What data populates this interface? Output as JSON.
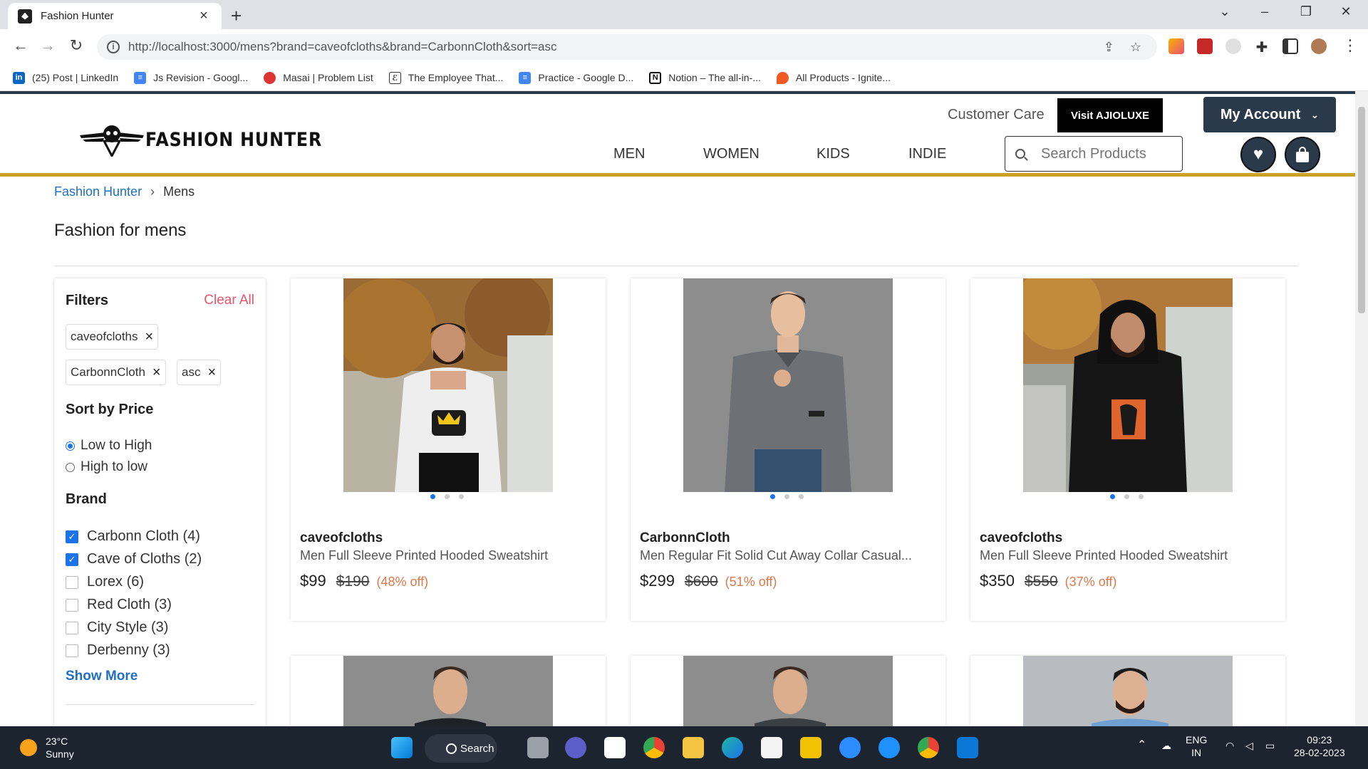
{
  "browser": {
    "tab_title": "Fashion Hunter",
    "url": "http://localhost:3000/mens?brand=caveofcloths&brand=CarbonnCloth&sort=asc",
    "bookmarks": [
      {
        "label": "(25) Post | LinkedIn",
        "icon": "linkedin-icon",
        "color": "#0a66c2"
      },
      {
        "label": "Js Revision - Googl...",
        "icon": "google-docs-icon",
        "color": "#4285f4"
      },
      {
        "label": "Masai | Problem List",
        "icon": "masai-icon",
        "color": "#d33"
      },
      {
        "label": "The Employee That...",
        "icon": "bookmark-icon",
        "color": "#333"
      },
      {
        "label": "Practice - Google D...",
        "icon": "google-docs-icon",
        "color": "#4285f4"
      },
      {
        "label": "Notion – The all-in-...",
        "icon": "notion-icon",
        "color": "#111"
      },
      {
        "label": "All Products - Ignite...",
        "icon": "flame-icon",
        "color": "#f05a22"
      }
    ]
  },
  "header": {
    "logo_text": "FASHION HUNTER",
    "customer_care": "Customer Care",
    "visit_button": "Visit AJIOLUXE",
    "account_button": "My Account",
    "nav": [
      "MEN",
      "WOMEN",
      "KIDS",
      "INDIE"
    ],
    "search_placeholder": "Search Products"
  },
  "breadcrumb": {
    "home": "Fashion Hunter",
    "current": "Mens"
  },
  "page_title": "Fashion for mens",
  "filters": {
    "title": "Filters",
    "clear_all": "Clear All",
    "chips": [
      "caveofcloths",
      "CarbonnCloth",
      "asc"
    ],
    "sort_title": "Sort by Price",
    "sort_options": [
      {
        "label": "Low to High",
        "selected": true
      },
      {
        "label": "High to low",
        "selected": false
      }
    ],
    "brand_title": "Brand",
    "brands": [
      {
        "label": "Carbonn Cloth (4)",
        "checked": true
      },
      {
        "label": "Cave of Cloths (2)",
        "checked": true
      },
      {
        "label": "Lorex (6)",
        "checked": false
      },
      {
        "label": "Red Cloth (3)",
        "checked": false
      },
      {
        "label": "City Style (3)",
        "checked": false
      },
      {
        "label": "Derbenny (3)",
        "checked": false
      }
    ],
    "show_more": "Show More"
  },
  "products": [
    {
      "brand": "caveofcloths",
      "name": "Men Full Sleeve Printed Hooded Sweatshirt",
      "price": "$99",
      "mrp": "$190",
      "off": "(48% off)",
      "garment_color": "#e8e8e8"
    },
    {
      "brand": "CarbonnCloth",
      "name": "Men Regular Fit Solid Cut Away Collar Casual...",
      "price": "$299",
      "mrp": "$600",
      "off": "(51% off)",
      "garment_color": "#6d7176"
    },
    {
      "brand": "caveofcloths",
      "name": "Men Full Sleeve Printed Hooded Sweatshirt",
      "price": "$350",
      "mrp": "$550",
      "off": "(37% off)",
      "garment_color": "#151515"
    }
  ],
  "taskbar": {
    "temp": "23°C",
    "weather": "Sunny",
    "search": "Search",
    "lang1": "ENG",
    "lang2": "IN",
    "time": "09:23",
    "date": "28-02-2023"
  }
}
